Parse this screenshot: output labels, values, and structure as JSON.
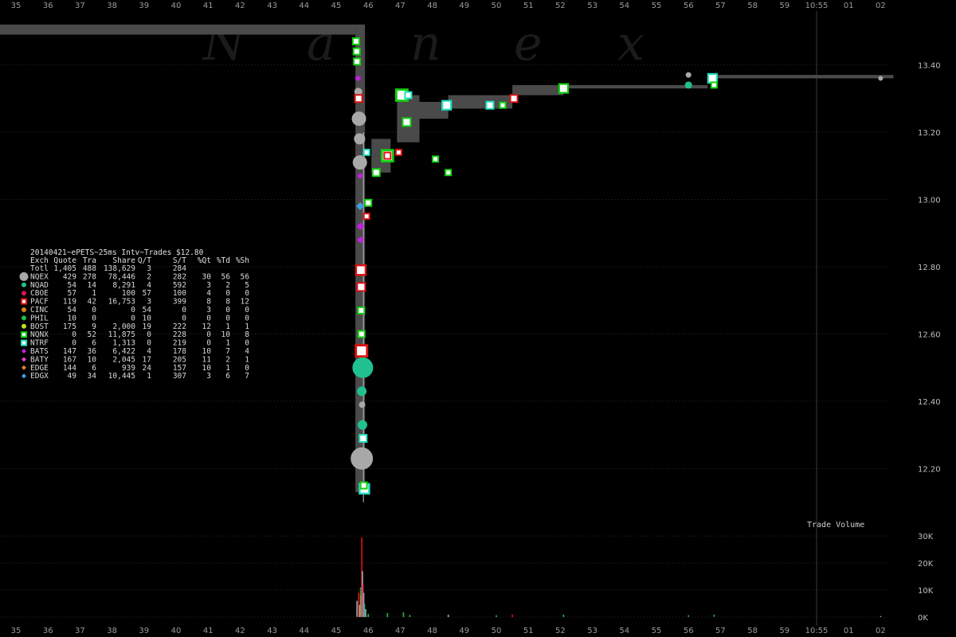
{
  "colors": {
    "background": "#000000",
    "nbbo_band": "#4a4a4a",
    "grid": "#2a2a2a",
    "cursor_line": "#3a3a3a"
  },
  "watermark": [
    "N",
    "a",
    "n",
    "e",
    "x"
  ],
  "x_axis": {
    "top_labels": [
      "35",
      "36",
      "37",
      "38",
      "39",
      "40",
      "41",
      "42",
      "43",
      "44",
      "45",
      "46",
      "47",
      "48",
      "49",
      "50",
      "51",
      "52",
      "53",
      "54",
      "55",
      "56",
      "57",
      "58",
      "59",
      "10:55",
      "01",
      "02"
    ],
    "bottom_labels": [
      "35",
      "36",
      "37",
      "38",
      "39",
      "40",
      "41",
      "42",
      "43",
      "44",
      "45",
      "46",
      "47",
      "48",
      "49",
      "50",
      "51",
      "52",
      "53",
      "54",
      "55",
      "56",
      "57",
      "58",
      "59",
      "10:55",
      "01",
      "02"
    ],
    "hour_marker_index": 25
  },
  "table": {
    "title": "20140421~ePETS~25ms Intv~Trades $12.80",
    "headers": [
      "Exch",
      "Quote",
      "Tra",
      "Share",
      "Q/T",
      "S/T",
      "%Qt",
      "%Td",
      "%Sh"
    ],
    "total": [
      "Totl",
      "1,405",
      "488",
      "138,629",
      "3",
      "284",
      "",
      "",
      ""
    ],
    "rows": [
      {
        "exch": "NQEX",
        "cells": [
          "429",
          "278",
          "78,446",
          "2",
          "282",
          "30",
          "56",
          "56"
        ],
        "color": "#a8a8a8",
        "shape": "circle",
        "big": true
      },
      {
        "exch": "NQAD",
        "cells": [
          "54",
          "14",
          "8,291",
          "4",
          "592",
          "3",
          "2",
          "5"
        ],
        "color": "#20c090",
        "shape": "circle"
      },
      {
        "exch": "CBOE",
        "cells": [
          "57",
          "1",
          "100",
          "57",
          "100",
          "4",
          "0",
          "0"
        ],
        "color": "#e01060",
        "shape": "circle"
      },
      {
        "exch": "PACF",
        "cells": [
          "119",
          "42",
          "16,753",
          "3",
          "399",
          "8",
          "8",
          "12"
        ],
        "color": "#e01010",
        "shape": "square"
      },
      {
        "exch": "CINC",
        "cells": [
          "54",
          "0",
          "0",
          "54",
          "0",
          "3",
          "0",
          "0"
        ],
        "color": "#e08020",
        "shape": "circle"
      },
      {
        "exch": "PHIL",
        "cells": [
          "10",
          "0",
          "0",
          "10",
          "0",
          "0",
          "0",
          "0"
        ],
        "color": "#20c040",
        "shape": "circle"
      },
      {
        "exch": "BOST",
        "cells": [
          "175",
          "9",
          "2,000",
          "19",
          "222",
          "12",
          "1",
          "1"
        ],
        "color": "#c0e020",
        "shape": "circle"
      },
      {
        "exch": "NQNX",
        "cells": [
          "0",
          "52",
          "11,875",
          "0",
          "228",
          "0",
          "10",
          "8"
        ],
        "color": "#10d010",
        "shape": "square"
      },
      {
        "exch": "NTRF",
        "cells": [
          "0",
          "6",
          "1,313",
          "0",
          "219",
          "0",
          "1",
          "0"
        ],
        "color": "#20e0c0",
        "shape": "square"
      },
      {
        "exch": "BATS",
        "cells": [
          "147",
          "36",
          "6,422",
          "4",
          "178",
          "10",
          "7",
          "4"
        ],
        "color": "#c020e0",
        "shape": "diamond"
      },
      {
        "exch": "BATY",
        "cells": [
          "167",
          "10",
          "2,045",
          "17",
          "205",
          "11",
          "2",
          "1"
        ],
        "color": "#e040c0",
        "shape": "diamond"
      },
      {
        "exch": "EDGE",
        "cells": [
          "144",
          "6",
          "939",
          "24",
          "157",
          "10",
          "1",
          "0"
        ],
        "color": "#e08030",
        "shape": "diamond"
      },
      {
        "exch": "EDGX",
        "cells": [
          "49",
          "34",
          "10,445",
          "1",
          "307",
          "3",
          "6",
          "7"
        ],
        "color": "#40a0e0",
        "shape": "diamond"
      }
    ]
  },
  "chart_data": [
    {
      "type": "scatter",
      "title": "",
      "xlabel": "",
      "ylabel": "",
      "y_ticks": [
        "13.40",
        "13.20",
        "13.00",
        "12.80",
        "12.60",
        "12.40",
        "12.20"
      ],
      "y_tick_values": [
        13.4,
        13.2,
        13.0,
        12.8,
        12.6,
        12.4,
        12.2
      ],
      "ylim": [
        12.09,
        13.51
      ],
      "xlim_minutes": [
        34.5,
        62.75
      ],
      "nbbo_band": [
        {
          "t0": 34.5,
          "t1": 45.6,
          "lo": 13.49,
          "hi": 13.52
        },
        {
          "t0": 45.6,
          "t1": 45.9,
          "lo": 12.13,
          "hi": 13.52
        },
        {
          "t0": 46.1,
          "t1": 46.7,
          "lo": 13.08,
          "hi": 13.18
        },
        {
          "t0": 46.9,
          "t1": 47.6,
          "lo": 13.17,
          "hi": 13.31
        },
        {
          "t0": 47.6,
          "t1": 48.5,
          "lo": 13.24,
          "hi": 13.29
        },
        {
          "t0": 48.5,
          "t1": 50.5,
          "lo": 13.27,
          "hi": 13.31
        },
        {
          "t0": 50.5,
          "t1": 52.1,
          "lo": 13.31,
          "hi": 13.34
        },
        {
          "t0": 52.1,
          "t1": 56.6,
          "lo": 13.33,
          "hi": 13.34
        },
        {
          "t0": 56.6,
          "t1": 62.4,
          "lo": 13.36,
          "hi": 13.37
        }
      ],
      "trades": [
        {
          "t": 45.62,
          "p": 13.47,
          "ex": "NQNX",
          "s": 8
        },
        {
          "t": 45.64,
          "p": 13.44,
          "ex": "NQNX",
          "s": 8
        },
        {
          "t": 45.65,
          "p": 13.41,
          "ex": "NQNX",
          "s": 8
        },
        {
          "t": 45.68,
          "p": 13.36,
          "ex": "BATS",
          "s": 8
        },
        {
          "t": 45.69,
          "p": 13.32,
          "ex": "NQEX",
          "s": 10
        },
        {
          "t": 45.7,
          "p": 13.3,
          "ex": "PACF",
          "s": 9
        },
        {
          "t": 45.71,
          "p": 13.24,
          "ex": "NQEX",
          "s": 18
        },
        {
          "t": 45.73,
          "p": 13.18,
          "ex": "NQEX",
          "s": 14
        },
        {
          "t": 45.74,
          "p": 13.11,
          "ex": "NQEX",
          "s": 18
        },
        {
          "t": 45.75,
          "p": 13.07,
          "ex": "BATS",
          "s": 8
        },
        {
          "t": 45.75,
          "p": 12.98,
          "ex": "EDGX",
          "s": 10
        },
        {
          "t": 45.76,
          "p": 12.92,
          "ex": "BATS",
          "s": 10
        },
        {
          "t": 45.76,
          "p": 12.88,
          "ex": "BATS",
          "s": 9
        },
        {
          "t": 45.77,
          "p": 12.79,
          "ex": "PACF",
          "s": 12
        },
        {
          "t": 45.78,
          "p": 12.74,
          "ex": "PACF",
          "s": 10
        },
        {
          "t": 45.78,
          "p": 12.67,
          "ex": "NQNX",
          "s": 8
        },
        {
          "t": 45.79,
          "p": 12.6,
          "ex": "NQNX",
          "s": 8
        },
        {
          "t": 45.79,
          "p": 12.55,
          "ex": "PACF",
          "s": 14
        },
        {
          "t": 45.83,
          "p": 12.5,
          "ex": "NQAD",
          "s": 26
        },
        {
          "t": 45.8,
          "p": 12.43,
          "ex": "NQAD",
          "s": 12
        },
        {
          "t": 45.81,
          "p": 12.39,
          "ex": "NQEX",
          "s": 8
        },
        {
          "t": 45.82,
          "p": 12.33,
          "ex": "NQAD",
          "s": 12
        },
        {
          "t": 45.84,
          "p": 12.29,
          "ex": "NTRF",
          "s": 9
        },
        {
          "t": 45.8,
          "p": 12.23,
          "ex": "NQEX",
          "s": 28
        },
        {
          "t": 45.88,
          "p": 12.14,
          "ex": "NTRF",
          "s": 12
        },
        {
          "t": 45.86,
          "p": 12.15,
          "ex": "NQNX",
          "s": 8
        },
        {
          "t": 45.95,
          "p": 12.95,
          "ex": "PACF",
          "s": 7
        },
        {
          "t": 45.95,
          "p": 13.14,
          "ex": "NTRF",
          "s": 7
        },
        {
          "t": 46.0,
          "p": 12.99,
          "ex": "NQNX",
          "s": 8
        },
        {
          "t": 46.25,
          "p": 13.08,
          "ex": "NQNX",
          "s": 9
        },
        {
          "t": 46.6,
          "p": 13.13,
          "ex": "NQNX",
          "s": 14
        },
        {
          "t": 46.6,
          "p": 13.13,
          "ex": "PACF",
          "s": 8
        },
        {
          "t": 46.95,
          "p": 13.14,
          "ex": "PACF",
          "s": 7
        },
        {
          "t": 47.05,
          "p": 13.31,
          "ex": "NQNX",
          "s": 14
        },
        {
          "t": 47.25,
          "p": 13.31,
          "ex": "NTRF",
          "s": 8
        },
        {
          "t": 47.2,
          "p": 13.23,
          "ex": "NQNX",
          "s": 10
        },
        {
          "t": 48.1,
          "p": 13.12,
          "ex": "NQNX",
          "s": 7
        },
        {
          "t": 48.5,
          "p": 13.08,
          "ex": "NQNX",
          "s": 7
        },
        {
          "t": 48.45,
          "p": 13.28,
          "ex": "NTRF",
          "s": 11
        },
        {
          "t": 49.8,
          "p": 13.28,
          "ex": "NTRF",
          "s": 9
        },
        {
          "t": 50.2,
          "p": 13.28,
          "ex": "NQNX",
          "s": 7
        },
        {
          "t": 50.55,
          "p": 13.3,
          "ex": "PACF",
          "s": 9
        },
        {
          "t": 52.1,
          "p": 13.33,
          "ex": "NQNX",
          "s": 11
        },
        {
          "t": 56.0,
          "p": 13.37,
          "ex": "NQEX",
          "s": 7
        },
        {
          "t": 56.0,
          "p": 13.34,
          "ex": "NQAD",
          "s": 9
        },
        {
          "t": 56.75,
          "p": 13.36,
          "ex": "NTRF",
          "s": 11
        },
        {
          "t": 56.8,
          "p": 13.34,
          "ex": "NQNX",
          "s": 7
        },
        {
          "t": 62.0,
          "p": 13.36,
          "ex": "NQEX",
          "s": 6
        }
      ]
    },
    {
      "type": "bar",
      "title": "Trade Volume",
      "y_ticks": [
        "30K",
        "20K",
        "10K",
        "0K"
      ],
      "y_tick_values": [
        30000,
        20000,
        10000,
        0
      ],
      "ylim": [
        0,
        33000
      ],
      "bars": [
        {
          "t": 45.65,
          "v": 6000,
          "c": "#a8a8a8"
        },
        {
          "t": 45.7,
          "v": 9000,
          "c": "#e01010"
        },
        {
          "t": 45.73,
          "v": 4500,
          "c": "#a8a8a8"
        },
        {
          "t": 45.76,
          "v": 11000,
          "c": "#20c040"
        },
        {
          "t": 45.78,
          "v": 8000,
          "c": "#a8a8a8"
        },
        {
          "t": 45.8,
          "v": 29500,
          "c": "#e01010"
        },
        {
          "t": 45.82,
          "v": 17000,
          "c": "#a8a8a8"
        },
        {
          "t": 45.84,
          "v": 12000,
          "c": "#e01060"
        },
        {
          "t": 45.86,
          "v": 9000,
          "c": "#a8a8a8"
        },
        {
          "t": 45.88,
          "v": 5000,
          "c": "#20c090"
        },
        {
          "t": 45.92,
          "v": 3000,
          "c": "#a8a8a8"
        },
        {
          "t": 46.0,
          "v": 1200,
          "c": "#20c040"
        },
        {
          "t": 46.6,
          "v": 1500,
          "c": "#20c040"
        },
        {
          "t": 47.1,
          "v": 1800,
          "c": "#20c040"
        },
        {
          "t": 47.3,
          "v": 800,
          "c": "#20c040"
        },
        {
          "t": 48.5,
          "v": 900,
          "c": "#a8a8a8"
        },
        {
          "t": 50.0,
          "v": 700,
          "c": "#20c040"
        },
        {
          "t": 50.5,
          "v": 1000,
          "c": "#e01010"
        },
        {
          "t": 52.1,
          "v": 900,
          "c": "#20c040"
        },
        {
          "t": 56.0,
          "v": 700,
          "c": "#20c040"
        },
        {
          "t": 56.8,
          "v": 900,
          "c": "#20c040"
        },
        {
          "t": 62.0,
          "v": 400,
          "c": "#a8a8a8"
        }
      ]
    }
  ]
}
